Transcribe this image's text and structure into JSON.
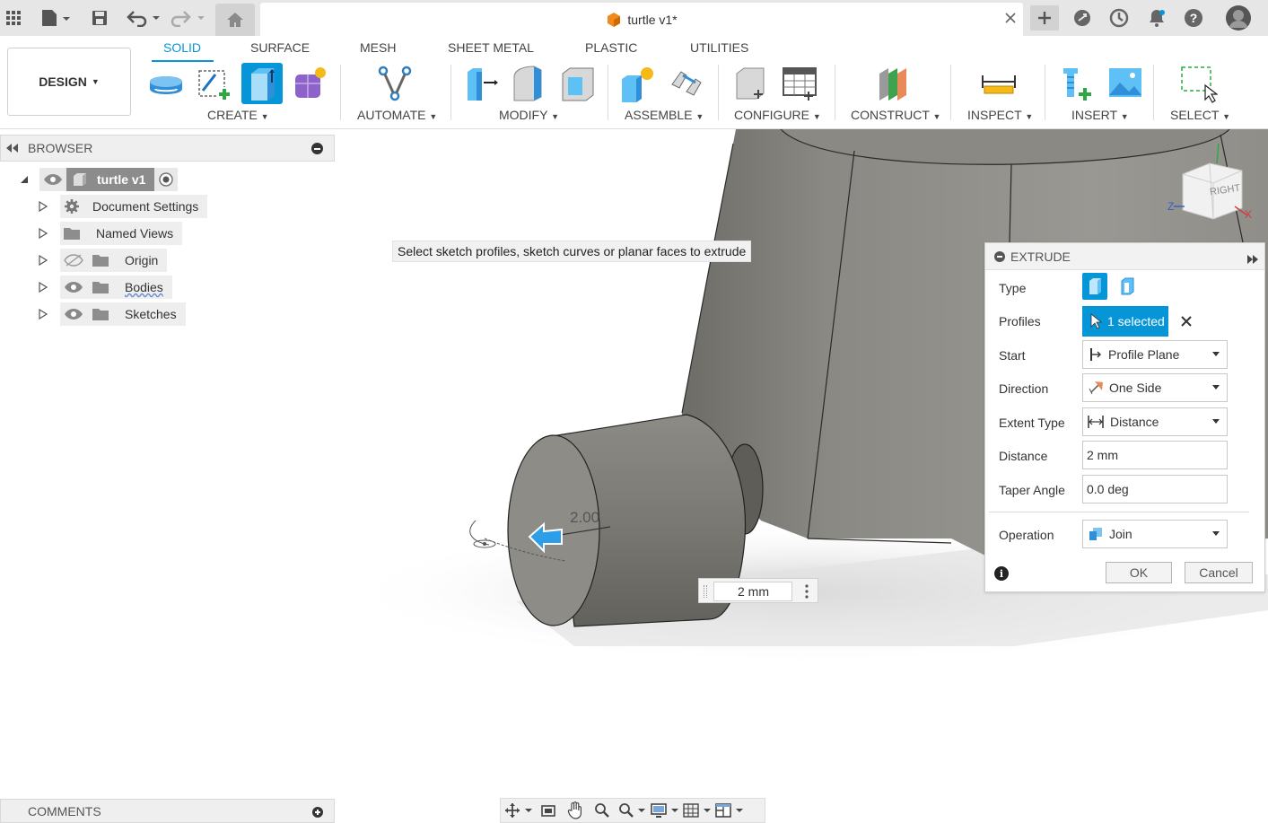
{
  "titlebar": {
    "document_title": "turtle v1*"
  },
  "toolbar": {
    "design_label": "DESIGN",
    "workspace_tabs": [
      "SOLID",
      "SURFACE",
      "MESH",
      "SHEET METAL",
      "PLASTIC",
      "UTILITIES"
    ],
    "active_tab": "SOLID",
    "groups": {
      "create": "CREATE",
      "automate": "AUTOMATE",
      "modify": "MODIFY",
      "assemble": "ASSEMBLE",
      "configure": "CONFIGURE",
      "construct": "CONSTRUCT",
      "inspect": "INSPECT",
      "insert": "INSERT",
      "select": "SELECT"
    }
  },
  "browser": {
    "title": "BROWSER",
    "root": "turtle v1",
    "items": [
      {
        "label": "Document Settings",
        "icon": "gear-icon"
      },
      {
        "label": "Named Views",
        "icon": "folder-icon"
      },
      {
        "label": "Origin",
        "icon": "folder-icon",
        "visibility": "hidden"
      },
      {
        "label": "Bodies",
        "icon": "folder-icon",
        "visibility": "visible"
      },
      {
        "label": "Sketches",
        "icon": "folder-icon",
        "visibility": "visible"
      }
    ]
  },
  "viewport": {
    "hint": "Select sketch profiles, sketch curves or planar faces to extrude",
    "dimension_label": "2.00",
    "dimension_input": "2 mm",
    "viewcube_label": "RIGHT",
    "axes": {
      "z": "Z",
      "x": "X"
    }
  },
  "extrude": {
    "title": "EXTRUDE",
    "fields": {
      "type": {
        "label": "Type"
      },
      "profiles": {
        "label": "Profiles",
        "value": "1 selected"
      },
      "start": {
        "label": "Start",
        "value": "Profile Plane"
      },
      "direction": {
        "label": "Direction",
        "value": "One Side"
      },
      "extent_type": {
        "label": "Extent Type",
        "value": "Distance"
      },
      "distance": {
        "label": "Distance",
        "value": "2 mm"
      },
      "taper_angle": {
        "label": "Taper Angle",
        "value": "0.0 deg"
      },
      "operation": {
        "label": "Operation",
        "value": "Join"
      }
    },
    "ok_label": "OK",
    "cancel_label": "Cancel"
  },
  "comments": {
    "title": "COMMENTS"
  },
  "colors": {
    "accent": "#0696d7",
    "model_gray": "#7e7d78",
    "toolbar_bg": "#ffffff",
    "titlebar_bg": "#e6e6e6"
  }
}
